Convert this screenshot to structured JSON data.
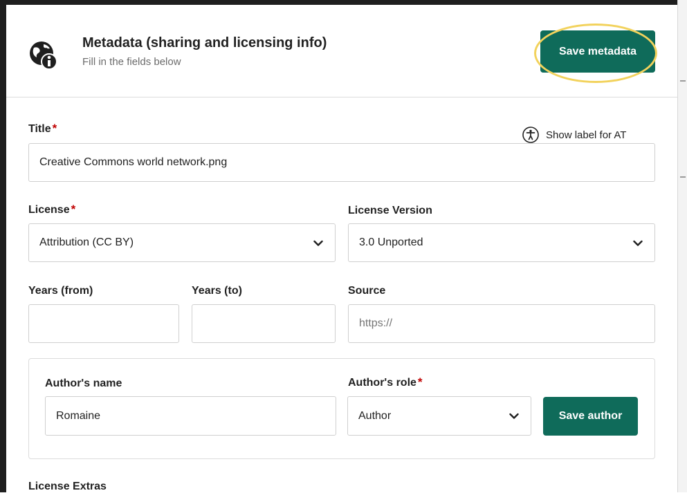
{
  "header": {
    "title": "Metadata (sharing and licensing info)",
    "subtitle": "Fill in the fields below",
    "save_label": "Save metadata",
    "icon": "globe-info-icon"
  },
  "accessibility": {
    "label": "Show label for AT",
    "icon": "accessibility-icon"
  },
  "fields": {
    "title": {
      "label": "Title",
      "required_mark": "*",
      "value": "Creative Commons world network.png"
    },
    "license": {
      "label": "License",
      "required_mark": "*",
      "value": "Attribution (CC BY)"
    },
    "license_version": {
      "label": "License Version",
      "value": "3.0 Unported"
    },
    "years_from": {
      "label": "Years (from)",
      "value": ""
    },
    "years_to": {
      "label": "Years (to)",
      "value": ""
    },
    "source": {
      "label": "Source",
      "value": "",
      "placeholder": "https://"
    }
  },
  "author": {
    "name_label": "Author's name",
    "name_value": "Romaine",
    "role_label": "Author's role",
    "role_required_mark": "*",
    "role_value": "Author",
    "save_label": "Save author"
  },
  "license_extras": {
    "label": "License Extras"
  },
  "colors": {
    "primary": "#0f6b5a",
    "highlight": "#f2d25c",
    "required": "#c00000"
  }
}
